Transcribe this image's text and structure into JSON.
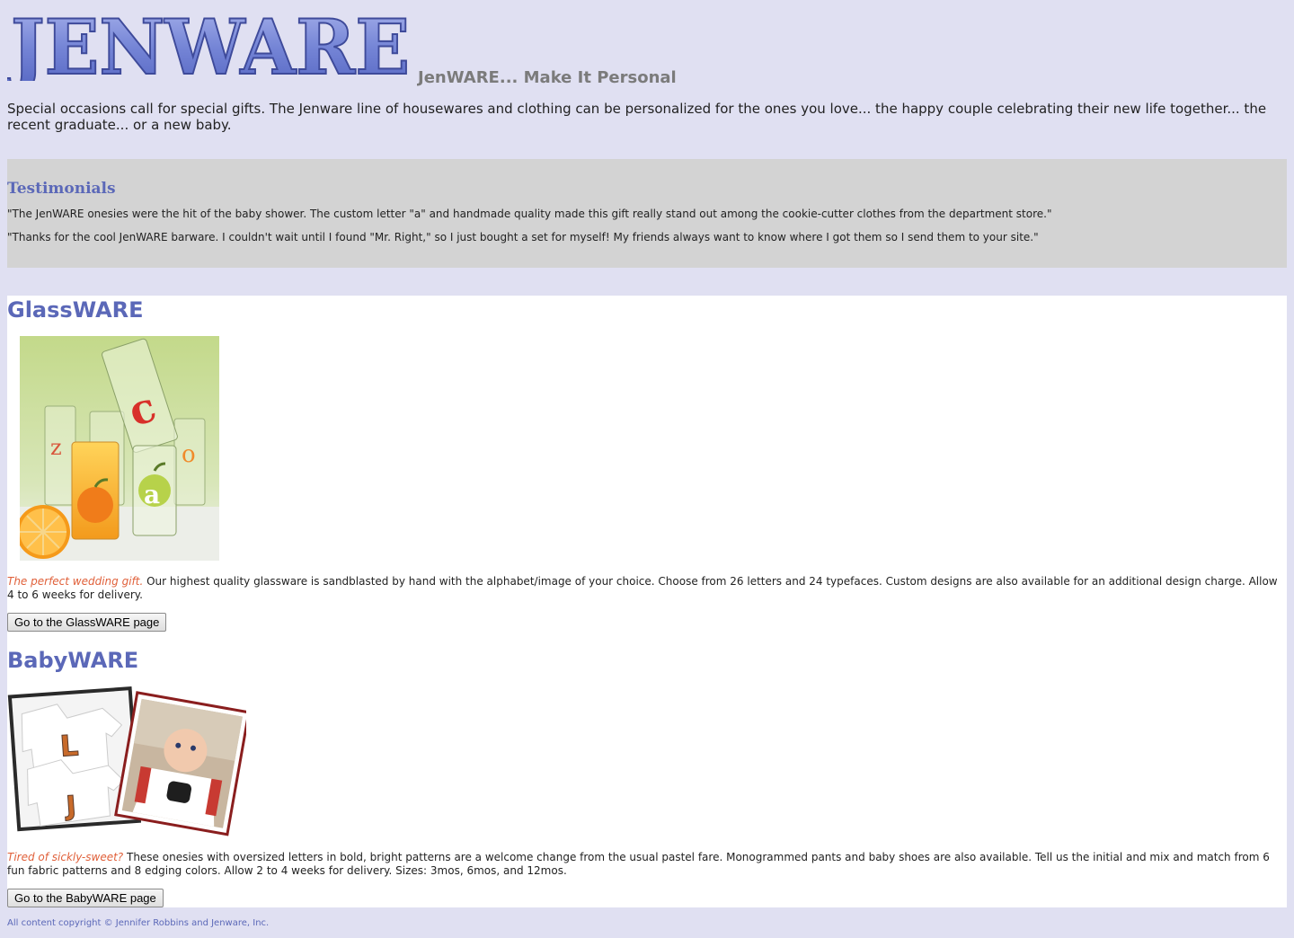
{
  "header": {
    "logo_text": "JENWARE",
    "tagline": "JenWARE... Make It Personal"
  },
  "intro": "Special occasions call for special gifts. The Jenware line of housewares and clothing can be personalized for the ones you love... the happy couple celebrating their new life together... the recent graduate... or a new baby.",
  "testimonials": {
    "heading": "Testimonials",
    "quotes": [
      "\"The JenWARE onesies were the hit of the baby shower. The custom letter \"a\" and handmade quality made this gift really stand out among the cookie-cutter clothes from the department store.\"",
      "\"Thanks for the cool JenWARE barware. I couldn't wait until I found \"Mr. Right,\" so I just bought a set for myself! My friends always want to know where I got them so I send them to your site.\""
    ]
  },
  "products": [
    {
      "title": "GlassWARE",
      "lead": "The perfect wedding gift.",
      "description": " Our highest quality glassware is sandblasted by hand with the alphabet/image of your choice. Choose from 26 letters and 24 typefaces. Custom designs are also available for an additional design charge. Allow 4 to 6 weeks for delivery.",
      "button_label": "Go to the GlassWARE page"
    },
    {
      "title": "BabyWARE",
      "lead": "Tired of sickly-sweet?",
      "description": " These onesies with oversized letters in bold, bright patterns are a welcome change from the usual pastel fare. Monogrammed pants and baby shoes are also available. Tell us the initial and mix and match from 6 fun fabric patterns and 8 edging colors. Allow 2 to 4 weeks for delivery. Sizes: 3mos, 6mos, and 12mos.",
      "button_label": "Go to the BabyWARE page"
    }
  ],
  "footer": "All content copyright © Jennifer Robbins and Jenware, Inc.",
  "colors": {
    "page_bg": "#e0e0f2",
    "accent": "#5b68b8",
    "lead_text": "#e0603a",
    "testimonial_bg": "#d3d3d3"
  }
}
